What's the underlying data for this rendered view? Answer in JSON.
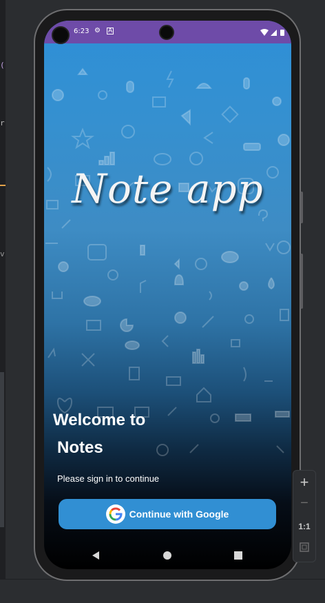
{
  "ide": {
    "left_marks": [
      "(",
      "r",
      "v"
    ]
  },
  "status_bar": {
    "time": "6:23",
    "icons": [
      "gear-icon",
      "a-box-icon",
      "wifi-icon",
      "signal-icon",
      "battery-icon"
    ]
  },
  "app": {
    "logo_text": "Note app",
    "welcome_line1": "Welcome to",
    "welcome_line2": "Notes",
    "subtitle": "Please sign in to continue",
    "google_button_label": "Continue with Google"
  },
  "emulator_controls": {
    "zoom_in": "+",
    "zoom_out": "−",
    "zoom_reset": "1:1"
  },
  "colors": {
    "status_bar": "#6e4ba8",
    "button": "#318fd3",
    "gradient_top": "#2e8fd7"
  }
}
